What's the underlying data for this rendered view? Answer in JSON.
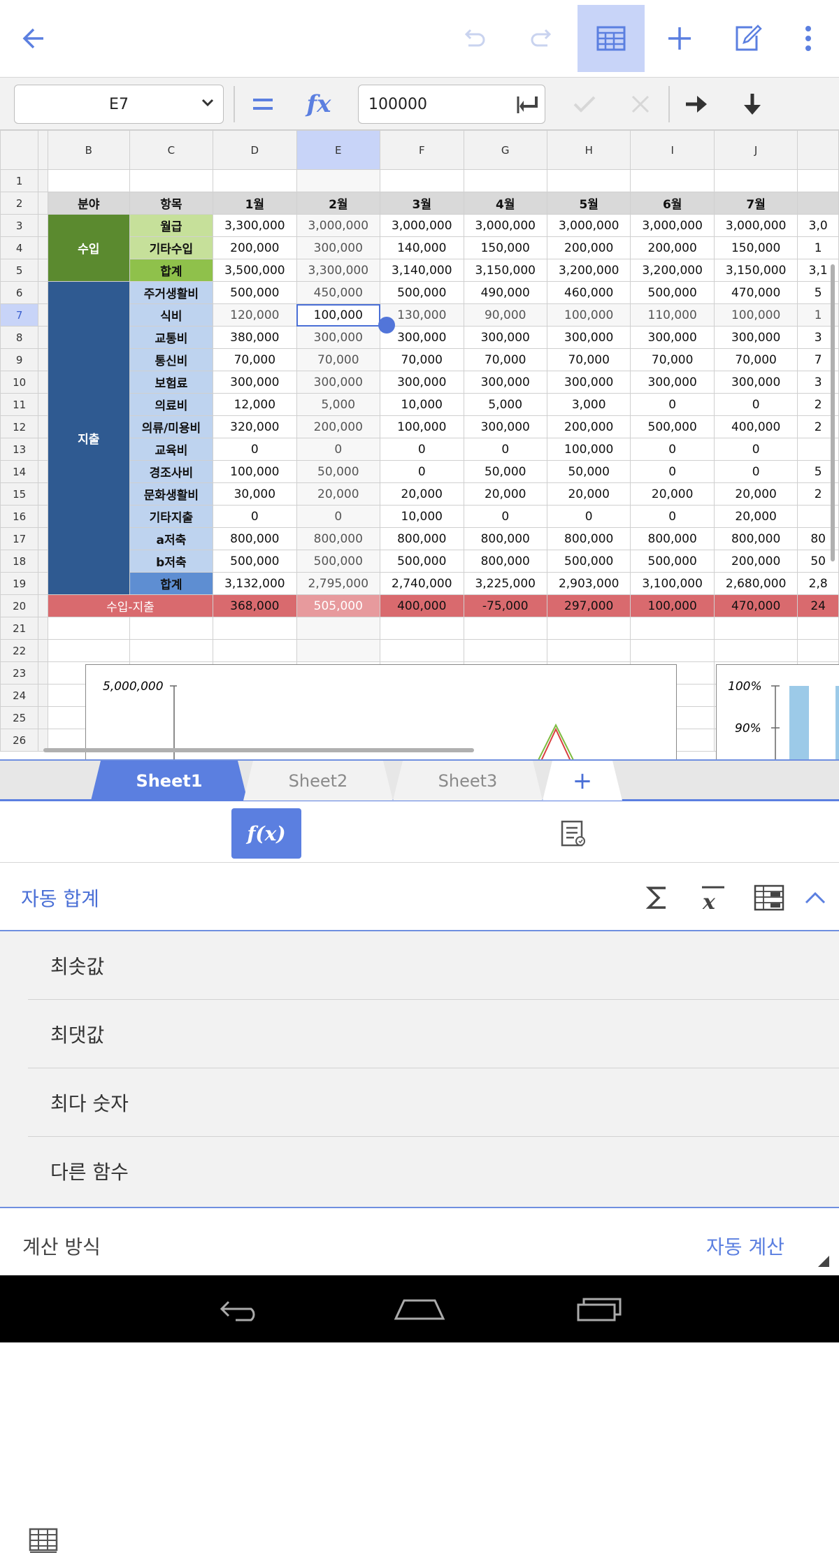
{
  "toolbar": {
    "icons": [
      "back-arrow-icon",
      "undo-icon",
      "redo-icon",
      "sheet-view-icon",
      "add-icon",
      "edit-icon",
      "more-icon"
    ],
    "accent": "#5b7fe0"
  },
  "formula_bar": {
    "cell_ref": "E7",
    "equals": "=",
    "fx": "fx",
    "value": "100000"
  },
  "sheet": {
    "columns": [
      "B",
      "C",
      "D",
      "E",
      "F",
      "G",
      "H",
      "I",
      "J"
    ],
    "row_numbers": [
      "1",
      "2",
      "3",
      "4",
      "5",
      "6",
      "7",
      "8",
      "9",
      "10",
      "11",
      "12",
      "13",
      "14",
      "15",
      "16",
      "17",
      "18",
      "19",
      "20",
      "21",
      "22",
      "23",
      "24",
      "25",
      "26"
    ],
    "header": {
      "b": "분야",
      "c": "항목",
      "months": [
        "1월",
        "2월",
        "3월",
        "4월",
        "5월",
        "6월",
        "7월"
      ]
    },
    "income_label": "수입",
    "expense_label": "지출",
    "net_label": "수입-지출",
    "items": [
      {
        "label": "월급",
        "values": [
          "3,300,000",
          "3,000,000",
          "3,000,000",
          "3,000,000",
          "3,000,000",
          "3,000,000",
          "3,000,000"
        ]
      },
      {
        "label": "기타수입",
        "values": [
          "200,000",
          "300,000",
          "140,000",
          "150,000",
          "200,000",
          "200,000",
          "150,000"
        ]
      },
      {
        "label": "합계",
        "values": [
          "3,500,000",
          "3,300,000",
          "3,140,000",
          "3,150,000",
          "3,200,000",
          "3,200,000",
          "3,150,000"
        ]
      },
      {
        "label": "주거생활비",
        "values": [
          "500,000",
          "450,000",
          "500,000",
          "490,000",
          "460,000",
          "500,000",
          "470,000"
        ]
      },
      {
        "label": "식비",
        "values": [
          "120,000",
          "100,000",
          "130,000",
          "90,000",
          "100,000",
          "110,000",
          "100,000"
        ]
      },
      {
        "label": "교통비",
        "values": [
          "380,000",
          "300,000",
          "300,000",
          "300,000",
          "300,000",
          "300,000",
          "300,000"
        ]
      },
      {
        "label": "통신비",
        "values": [
          "70,000",
          "70,000",
          "70,000",
          "70,000",
          "70,000",
          "70,000",
          "70,000"
        ]
      },
      {
        "label": "보험료",
        "values": [
          "300,000",
          "300,000",
          "300,000",
          "300,000",
          "300,000",
          "300,000",
          "300,000"
        ]
      },
      {
        "label": "의료비",
        "values": [
          "12,000",
          "5,000",
          "10,000",
          "5,000",
          "3,000",
          "0",
          "0"
        ]
      },
      {
        "label": "의류/미용비",
        "values": [
          "320,000",
          "200,000",
          "100,000",
          "300,000",
          "200,000",
          "500,000",
          "400,000"
        ]
      },
      {
        "label": "교육비",
        "values": [
          "0",
          "0",
          "0",
          "0",
          "100,000",
          "0",
          "0"
        ]
      },
      {
        "label": "경조사비",
        "values": [
          "100,000",
          "50,000",
          "0",
          "50,000",
          "50,000",
          "0",
          "0"
        ]
      },
      {
        "label": "문화생활비",
        "values": [
          "30,000",
          "20,000",
          "20,000",
          "20,000",
          "20,000",
          "20,000",
          "20,000"
        ]
      },
      {
        "label": "기타지출",
        "values": [
          "0",
          "0",
          "10,000",
          "0",
          "0",
          "0",
          "20,000"
        ]
      },
      {
        "label": "a저축",
        "values": [
          "800,000",
          "800,000",
          "800,000",
          "800,000",
          "800,000",
          "800,000",
          "800,000"
        ]
      },
      {
        "label": "b저축",
        "values": [
          "500,000",
          "500,000",
          "500,000",
          "800,000",
          "500,000",
          "500,000",
          "200,000"
        ]
      },
      {
        "label": "합계",
        "values": [
          "3,132,000",
          "2,795,000",
          "2,740,000",
          "3,225,000",
          "2,903,000",
          "3,100,000",
          "2,680,000"
        ]
      }
    ],
    "net_values": [
      "368,000",
      "505,000",
      "400,000",
      "-75,000",
      "297,000",
      "100,000",
      "470,000"
    ],
    "partial_k": [
      "3,0",
      "1",
      "3,1",
      "5",
      "1",
      "3",
      "7",
      "3",
      "2",
      "2",
      "",
      "5",
      "2",
      "",
      "80",
      "50",
      "2,8",
      "24"
    ]
  },
  "chart_data": [
    {
      "type": "line",
      "y_tick_labels": [
        "5,000,000"
      ]
    },
    {
      "type": "bar",
      "y_tick_labels": [
        "100%",
        "90%"
      ]
    }
  ],
  "tabs": {
    "sheets": [
      "Sheet1",
      "Sheet2",
      "Sheet3"
    ],
    "add": "+"
  },
  "panel": {
    "tab_fx": "f(x)",
    "section_title": "자동 합계",
    "functions": [
      "최솟값",
      "최댓값",
      "최다 숫자",
      "다른 함수"
    ],
    "calc_label": "계산 방식",
    "calc_value": "자동 계산"
  }
}
